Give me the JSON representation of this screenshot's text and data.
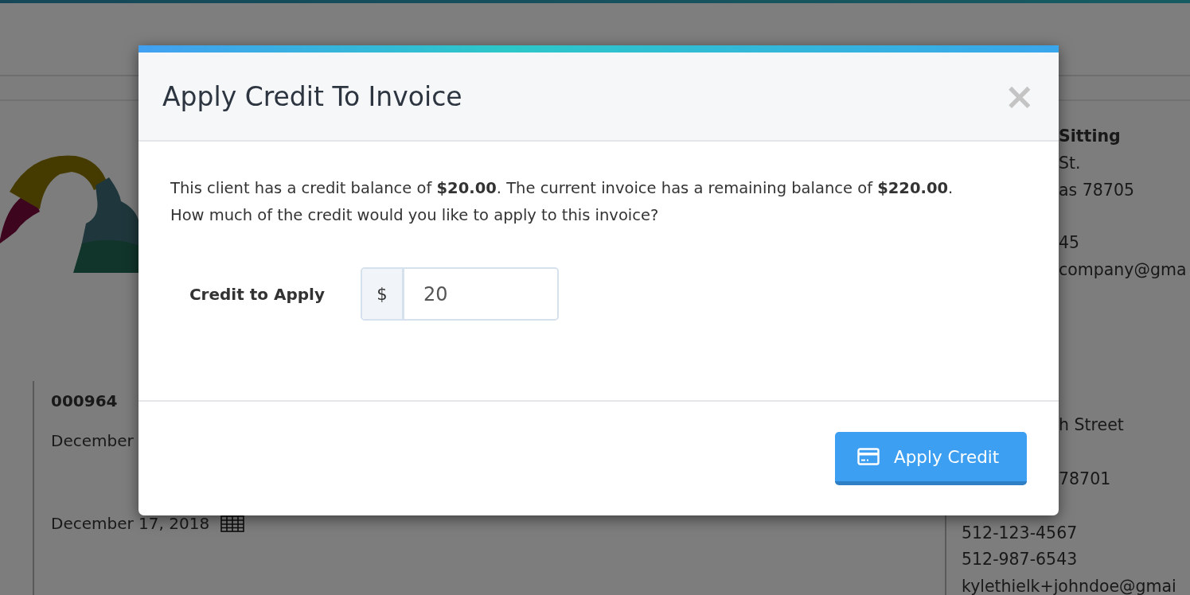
{
  "background": {
    "invoice": {
      "number": "000964",
      "dates": [
        "December",
        "December 17, 2018"
      ]
    },
    "company": {
      "lines": [
        "Sitting",
        "St.",
        "as 78705",
        "45",
        "company@gma"
      ]
    },
    "client": {
      "covered_lines": [
        "h Street",
        "78701"
      ],
      "lines": [
        "512-123-4567",
        "512-987-6543",
        "kylethielk+johndoe@gmai"
      ]
    }
  },
  "modal": {
    "title": "Apply Credit To Invoice",
    "close": "×",
    "message": "This client has a credit balance of **$20.00**. The current invoice has a remaining balance of **$220.00**. How much of the credit would you like to apply to this invoice?",
    "field": {
      "label": "Credit to Apply",
      "prefix": "$",
      "value": "20"
    },
    "button": "Apply Credit"
  }
}
